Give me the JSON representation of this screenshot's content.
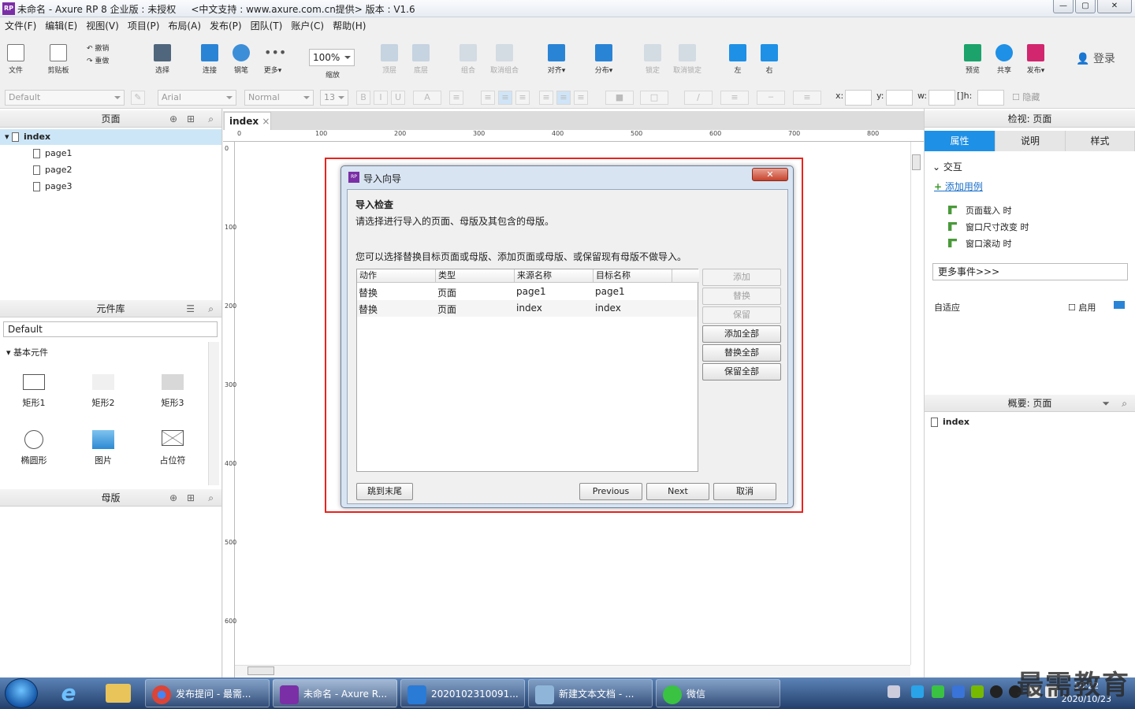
{
  "window": {
    "title": "未命名 - Axure RP 8 企业版 : 未授权",
    "support": "<中文支持 : www.axure.com.cn提供> 版本 : V1.6",
    "min": "—",
    "max": "▢",
    "close": "✕"
  },
  "menu": [
    "文件(F)",
    "编辑(E)",
    "视图(V)",
    "项目(P)",
    "布局(A)",
    "发布(P)",
    "团队(T)",
    "账户(C)",
    "帮助(H)"
  ],
  "toolbar": {
    "file": "文件",
    "clipboard": "剪贴板",
    "undo": "撤销",
    "redo": "重做",
    "select": "选择",
    "connect": "连接",
    "pen": "钢笔",
    "more": "更多▾",
    "zoom": "100%",
    "zoom_label": "缩放",
    "top": "顶层",
    "bottom": "底层",
    "group": "组合",
    "ungroup": "取消组合",
    "align": "对齐▾",
    "distribute": "分布▾",
    "lock": "锁定",
    "unlock": "取消锁定",
    "left": "左",
    "right": "右",
    "preview": "预览",
    "share": "共享",
    "publish": "发布▾",
    "login": "登录"
  },
  "format": {
    "style": "Default",
    "font": "Arial",
    "weight": "Normal",
    "size": "13",
    "x": "x:",
    "y": "y:",
    "w": "w:",
    "h": "h:",
    "hide": "隐藏"
  },
  "pages": {
    "header": "页面",
    "items": [
      "index",
      "page1",
      "page2",
      "page3"
    ]
  },
  "library": {
    "header": "元件库",
    "select": "Default",
    "group": "基本元件",
    "widgets": [
      "矩形1",
      "矩形2",
      "矩形3",
      "椭圆形",
      "图片",
      "占位符"
    ]
  },
  "masters": {
    "header": "母版"
  },
  "canvas": {
    "tab": "index",
    "tab_close": "×",
    "ruler_h": [
      "0",
      "100",
      "200",
      "300",
      "400",
      "500",
      "600",
      "700",
      "800"
    ],
    "ruler_v": [
      "0",
      "100",
      "200",
      "300",
      "400",
      "500",
      "600"
    ]
  },
  "inspector": {
    "header": "检视: 页面",
    "tabs": [
      "属性",
      "说明",
      "样式"
    ],
    "interaction": "交互",
    "add_case": "添加用例",
    "events": [
      "页面载入 时",
      "窗口尺寸改变 时",
      "窗口滚动 时"
    ],
    "more_events": "更多事件>>>",
    "adaptive": "自适应",
    "enable": "启用"
  },
  "outline": {
    "header": "概要: 页面",
    "item": "index"
  },
  "dialog": {
    "title": "导入向导",
    "heading": "导入检查",
    "desc1": "请选择进行导入的页面、母版及其包含的母版。",
    "desc2": "您可以选择替换目标页面或母版、添加页面或母版、或保留现有母版不做导入。",
    "columns": [
      "动作",
      "类型",
      "来源名称",
      "目标名称"
    ],
    "rows": [
      [
        "替换",
        "页面",
        "page1",
        "page1"
      ],
      [
        "替换",
        "页面",
        "index",
        "index"
      ]
    ],
    "side_buttons": [
      "添加",
      "替换",
      "保留",
      "添加全部",
      "替换全部",
      "保留全部"
    ],
    "skip": "跳到末尾",
    "previous": "Previous",
    "next": "Next",
    "cancel": "取消",
    "close": "✕"
  },
  "taskbar": {
    "apps": [
      "发布提问 - 最需...",
      "未命名 - Axure R...",
      "2020102310091...",
      "新建文本文档 - ...",
      "微信"
    ],
    "time": "10:22",
    "date": "2020/10/23"
  },
  "watermark": "最需教育"
}
